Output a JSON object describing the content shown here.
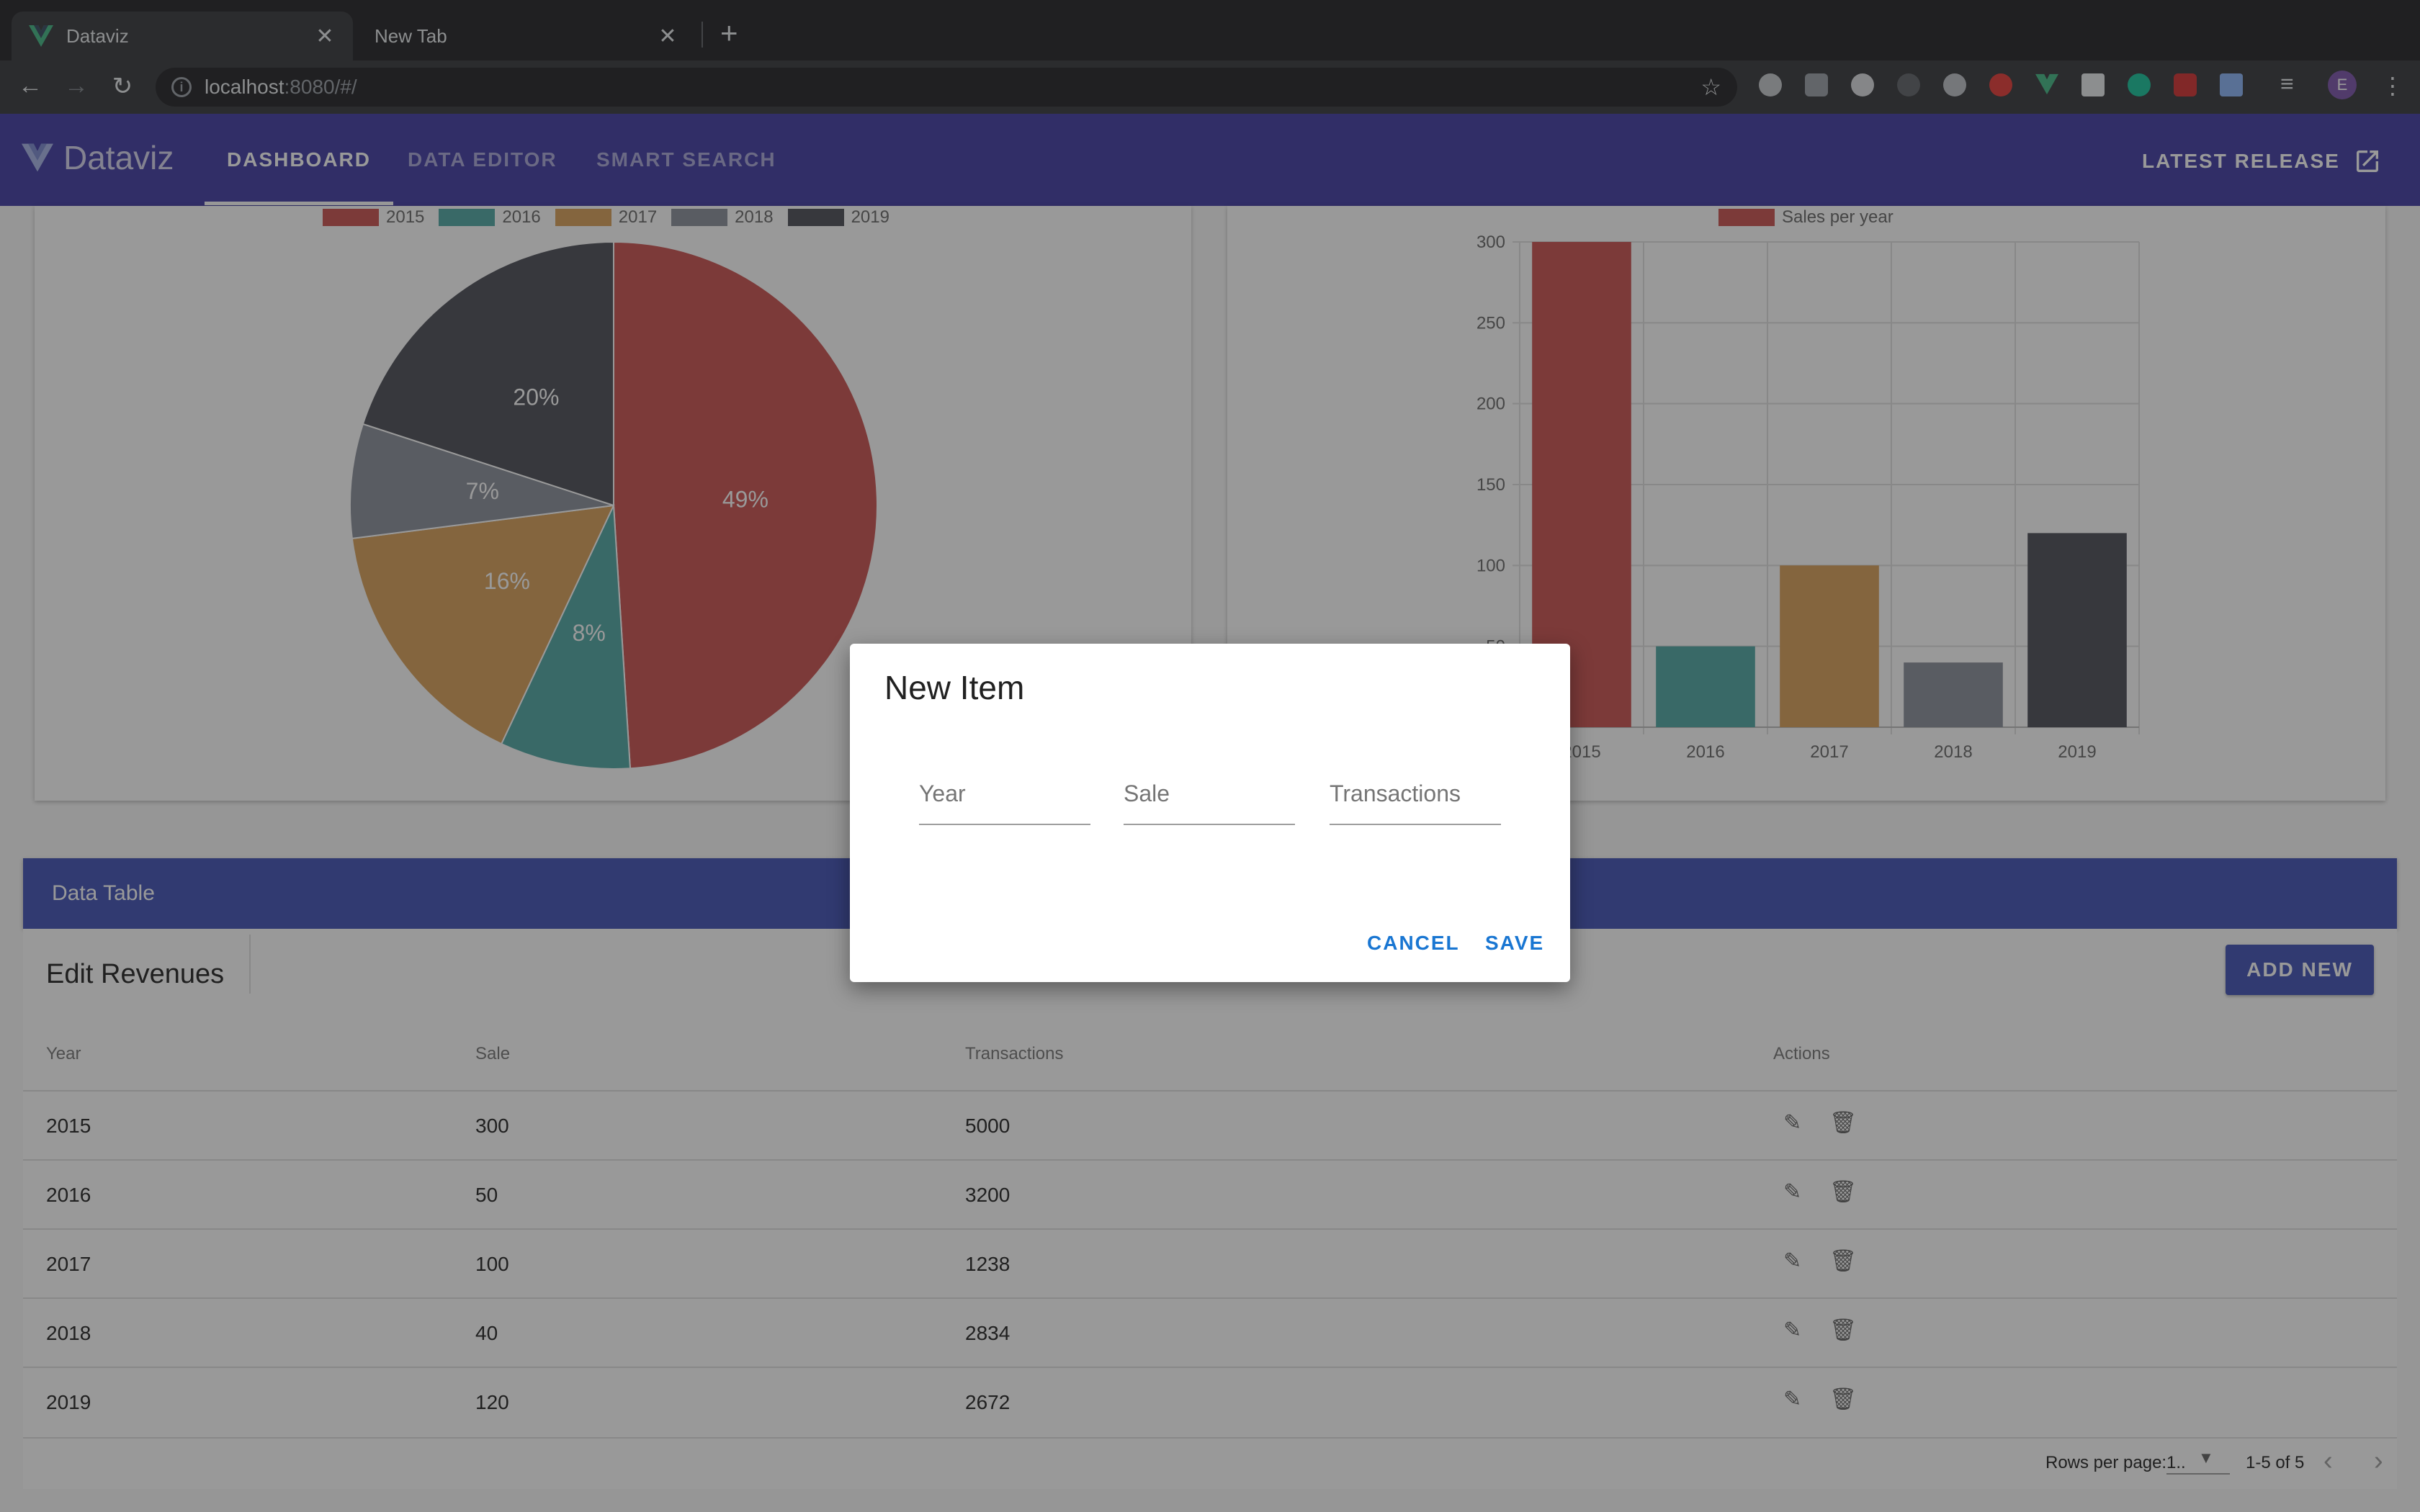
{
  "browser": {
    "tabs": [
      {
        "title": "Dataviz",
        "active": true
      },
      {
        "title": "New Tab",
        "active": false
      }
    ],
    "url_host": "localhost",
    "url_rest": ":8080/#/",
    "avatar_letter": "E"
  },
  "app": {
    "brand": "Dataviz",
    "nav": [
      "DASHBOARD",
      "DATA EDITOR",
      "SMART SEARCH"
    ],
    "active_nav": "DASHBOARD",
    "release_label": "LATEST RELEASE"
  },
  "chart_data": [
    {
      "type": "pie",
      "categories": [
        "2015",
        "2016",
        "2017",
        "2018",
        "2019"
      ],
      "values": [
        49,
        8,
        16,
        7,
        20
      ],
      "labels": [
        "49%",
        "8%",
        "16%",
        "7%",
        "20%"
      ],
      "colors": [
        "#c9504f",
        "#4fa6a3",
        "#d8a058",
        "#8a8e9a",
        "#4a4d56"
      ],
      "legend": "top"
    },
    {
      "type": "bar",
      "categories": [
        "2015",
        "2016",
        "2017",
        "2018",
        "2019"
      ],
      "series": [
        {
          "name": "Sales per year",
          "values": [
            300,
            50,
            100,
            40,
            120
          ]
        }
      ],
      "colors": [
        "#c9504f",
        "#4fa6a3",
        "#d8a058",
        "#8a8e9a",
        "#4a4d56"
      ],
      "yticks": [
        "300",
        "250",
        "200",
        "150",
        "100",
        "50"
      ],
      "ylim": [
        0,
        300
      ],
      "grid": true,
      "legend": "top"
    }
  ],
  "table": {
    "header": "Data Table",
    "title": "Edit Revenues",
    "add_label": "ADD NEW",
    "columns": [
      "Year",
      "Sale",
      "Transactions",
      "Actions"
    ],
    "rows": [
      [
        "2015",
        "300",
        "5000"
      ],
      [
        "2016",
        "50",
        "3200"
      ],
      [
        "2017",
        "100",
        "1238"
      ],
      [
        "2018",
        "40",
        "2834"
      ],
      [
        "2019",
        "120",
        "2672"
      ]
    ],
    "rows_per_page_label": "Rows per page:",
    "rows_per_page_value": "1..",
    "range_label": "1-5 of 5"
  },
  "dialog": {
    "title": "New Item",
    "fields": [
      {
        "placeholder": "Year",
        "value": ""
      },
      {
        "placeholder": "Sale",
        "value": ""
      },
      {
        "placeholder": "Transactions",
        "value": ""
      }
    ],
    "cancel_label": "CANCEL",
    "save_label": "SAVE"
  }
}
